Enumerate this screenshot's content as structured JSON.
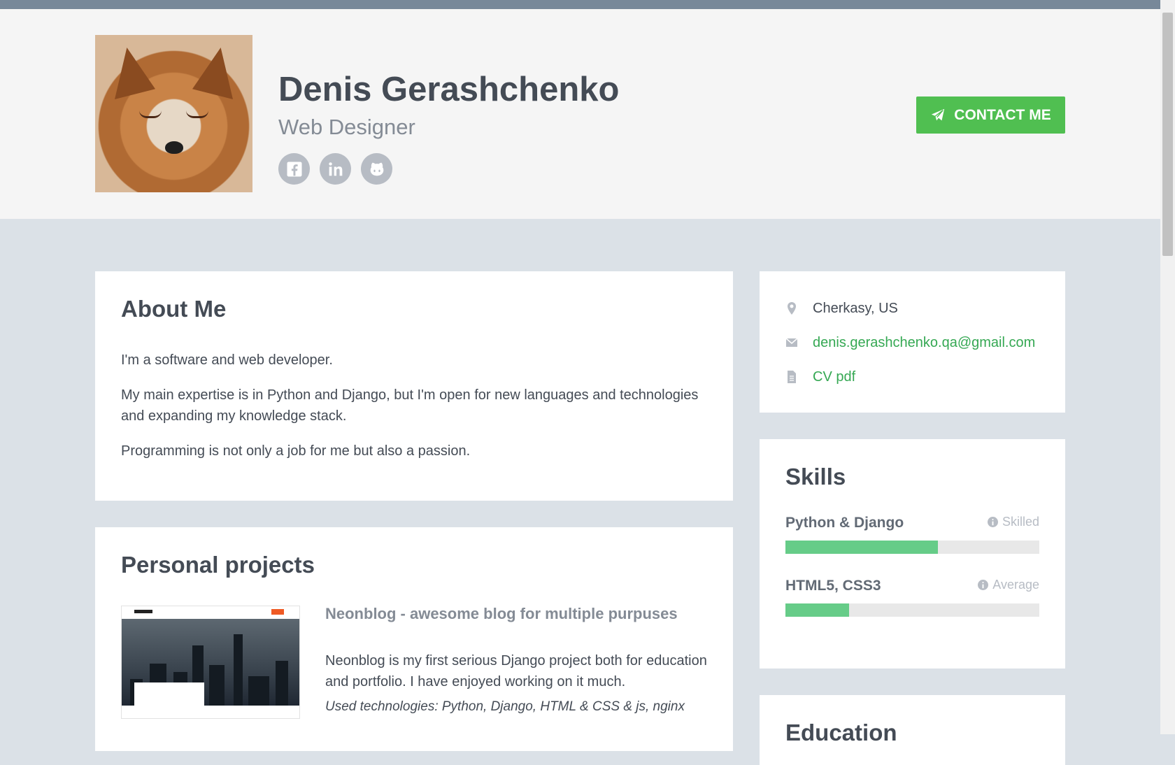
{
  "profile": {
    "name": "Denis Gerashchenko",
    "role": "Web Designer",
    "contact_button": "CONTACT ME"
  },
  "social": [
    {
      "name": "facebook-icon"
    },
    {
      "name": "linkedin-icon"
    },
    {
      "name": "github-icon"
    }
  ],
  "about": {
    "title": "About Me",
    "paragraphs": [
      "I'm a software and web developer.",
      "My main expertise is in Python and Django, but I'm open for new languages and technologies and expanding my knowledge stack.",
      "Programming is not only a job for me but also a passion."
    ]
  },
  "projects": {
    "title": "Personal projects",
    "items": [
      {
        "title": "Neonblog - awesome blog for multiple purpuses",
        "description": "Neonblog is my first serious Django project both for education and portfolio. I have enjoyed working on it much.",
        "technologies": "Used technologies: Python, Django, HTML & CSS & js, nginx"
      }
    ]
  },
  "info": {
    "location": "Cherkasy, US",
    "email": "denis.gerashchenko.qa@gmail.com",
    "cv": "CV pdf"
  },
  "skills": {
    "title": "Skills",
    "items": [
      {
        "name": "Python & Django",
        "level": "Skilled",
        "progress": 0.6
      },
      {
        "name": "HTML5, CSS3",
        "level": "Average",
        "progress": 0.25
      }
    ]
  },
  "education": {
    "title": "Education"
  },
  "colors": {
    "accent": "#50bf51",
    "link": "#35a853",
    "skill_bar": "#66cc88",
    "page_bg": "#dbe1e7",
    "header_bg": "#f5f5f5"
  }
}
